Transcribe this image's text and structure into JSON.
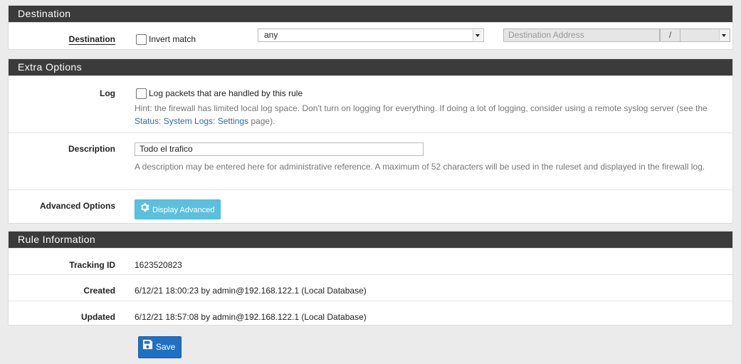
{
  "destination": {
    "heading": "Destination",
    "label": "Destination",
    "invert_label": "Invert match",
    "type_value": "any",
    "address_placeholder": "Destination Address",
    "slash": "/"
  },
  "extra": {
    "heading": "Extra Options",
    "log_label": "Log",
    "log_checkbox_label": "Log packets that are handled by this rule",
    "log_hint_before": "Hint: the firewall has limited local log space. Don't turn on logging for everything. If doing a lot of logging, consider using a remote syslog server (see the ",
    "log_hint_link": "Status: System Logs: Settings",
    "log_hint_after": " page).",
    "description_label": "Description",
    "description_value": "Todo el trafico",
    "description_hint": "A description may be entered here for administrative reference. A maximum of 52 characters will be used in the ruleset and displayed in the firewall log.",
    "advanced_label": "Advanced Options",
    "advanced_button": "Display Advanced"
  },
  "rule_info": {
    "heading": "Rule Information",
    "tracking_label": "Tracking ID",
    "tracking_value": "1623520823",
    "created_label": "Created",
    "created_value": "6/12/21 18:00:23 by admin@192.168.122.1 (Local Database)",
    "updated_label": "Updated",
    "updated_value": "6/12/21 18:57:08 by admin@192.168.122.1 (Local Database)"
  },
  "save_label": "Save",
  "colors": {
    "panel_heading": "#3b3b3b",
    "info_button": "#5bc0de",
    "primary_button": "#1f6fc5",
    "link": "#2e6da4"
  }
}
